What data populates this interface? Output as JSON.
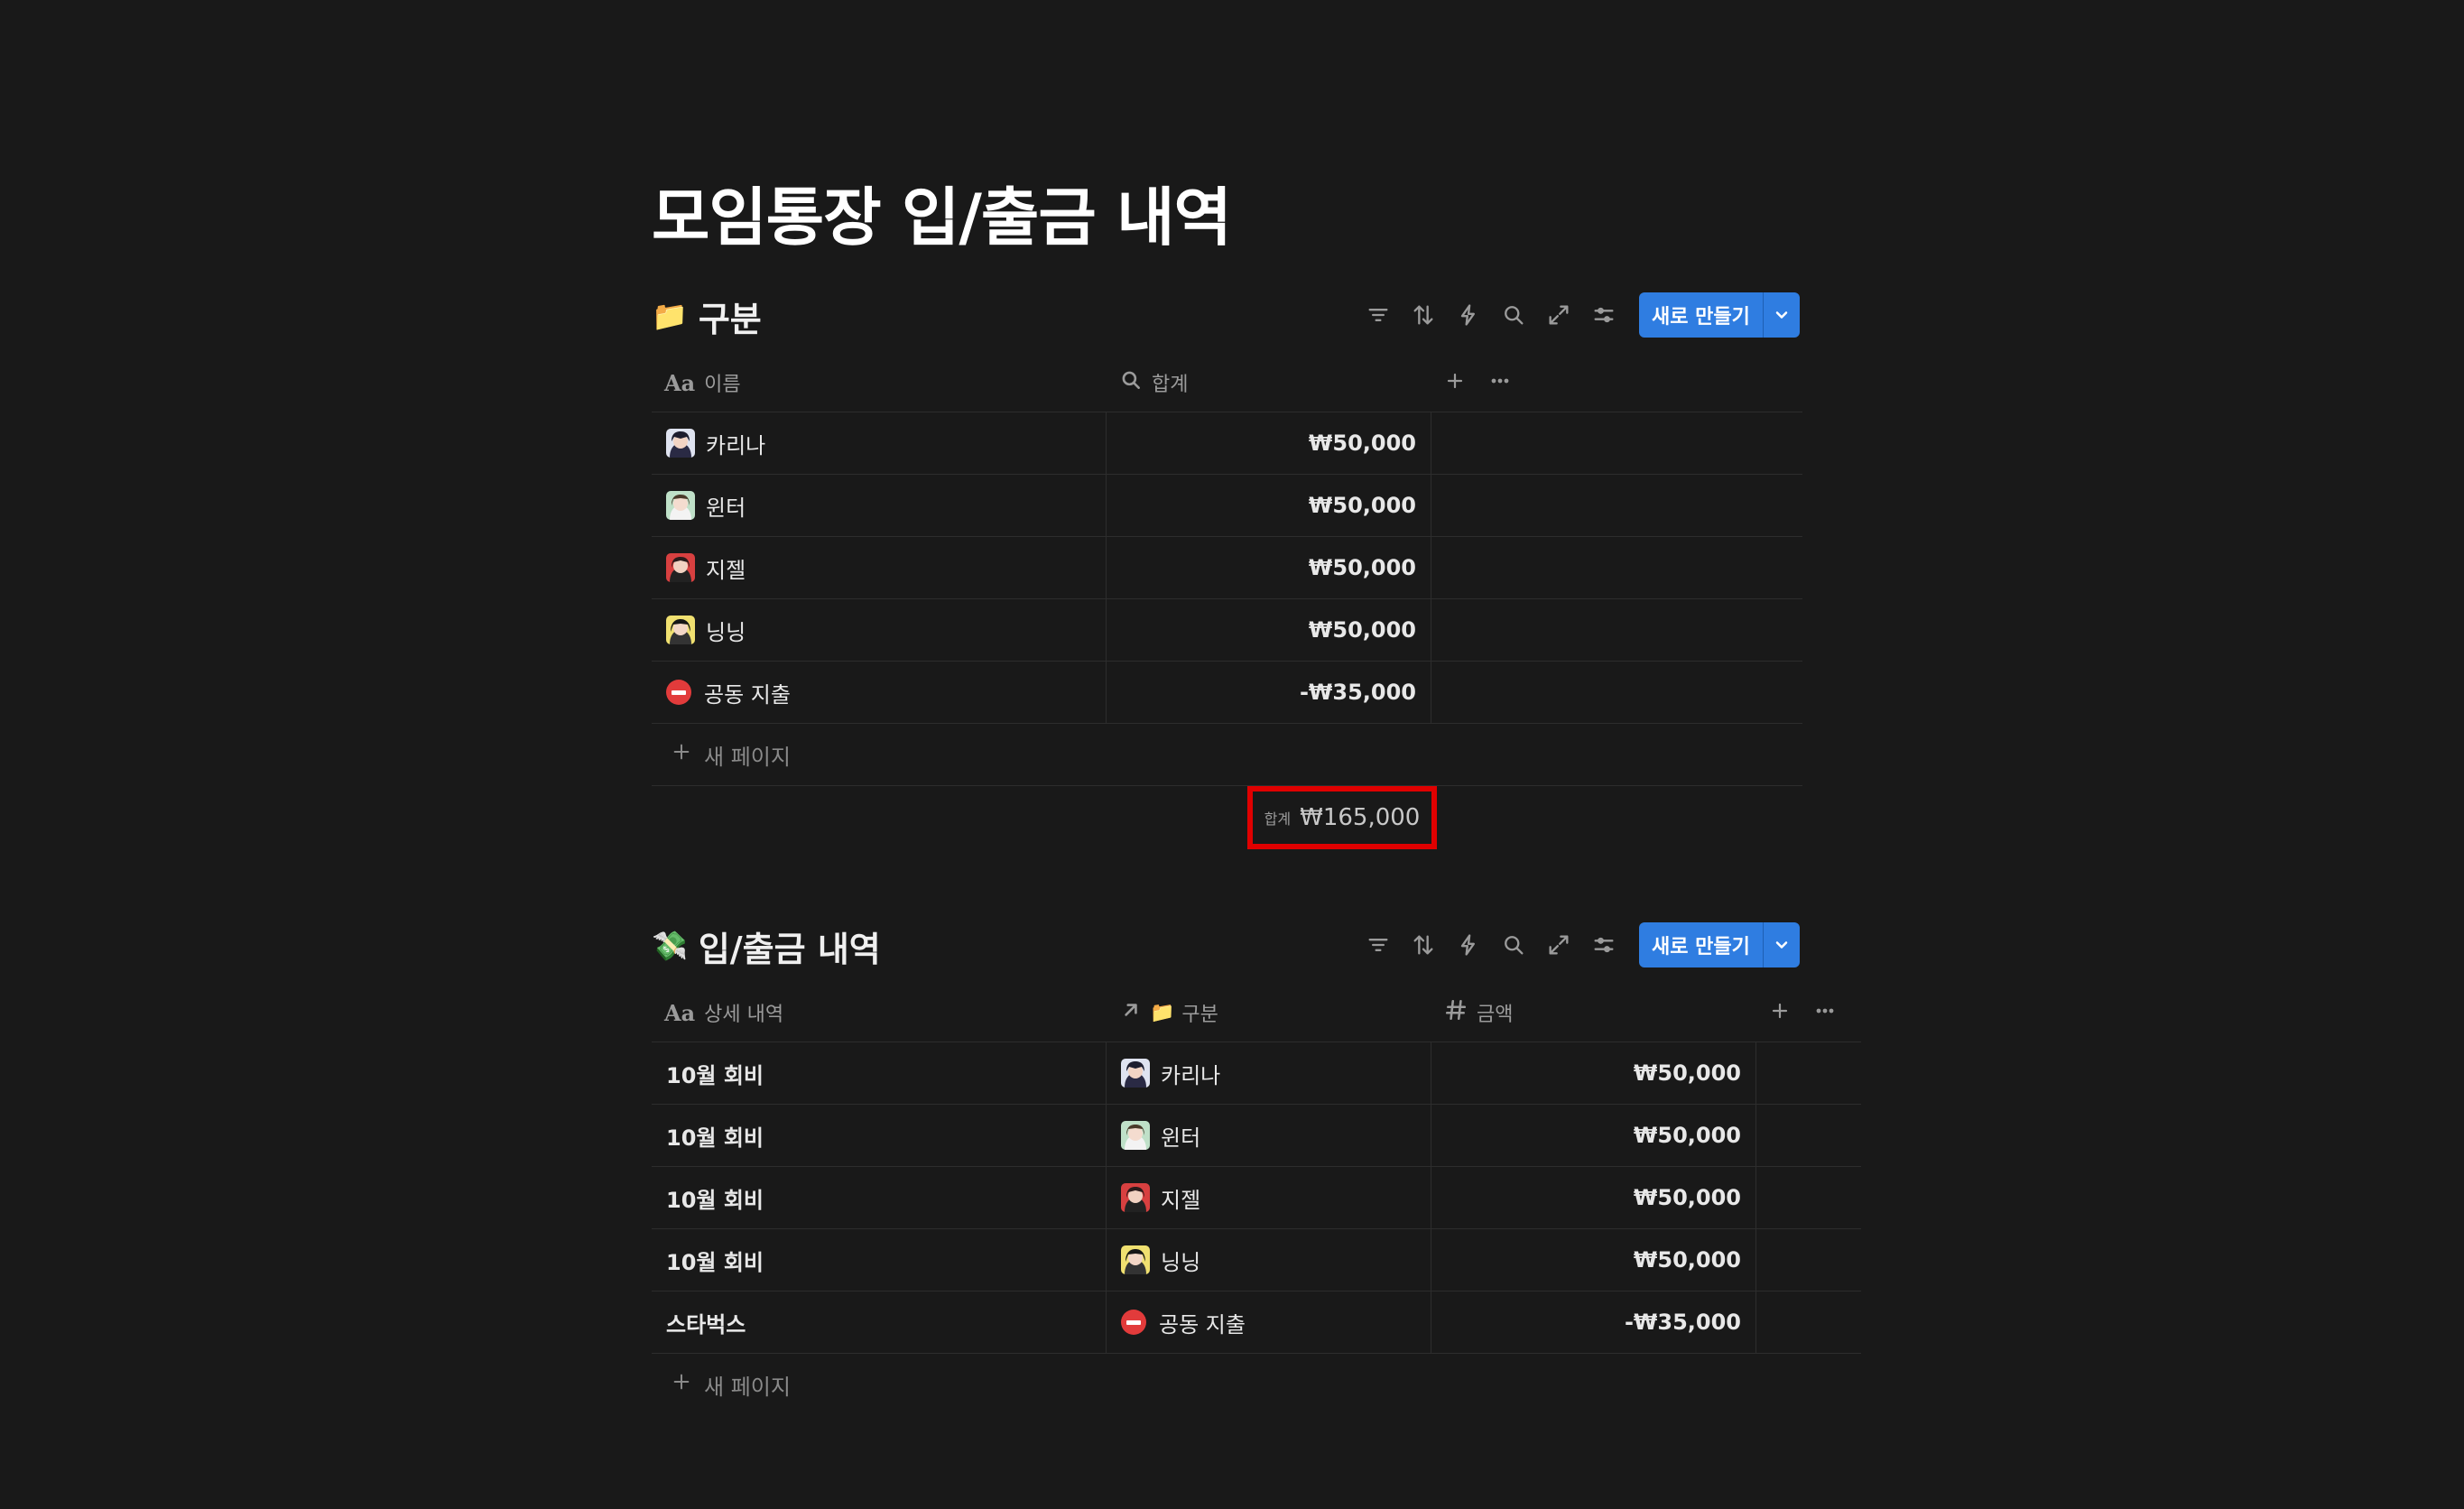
{
  "page": {
    "title": "모임통장 입/출금 내역"
  },
  "db1": {
    "title": "구분",
    "title_emoji": "📁",
    "new_button_label": "새로 만들기",
    "columns": [
      {
        "label": "이름",
        "icon": "title-aa-icon"
      },
      {
        "label": "합계",
        "icon": "search-formula-icon"
      }
    ],
    "rows": [
      {
        "name": "카리나",
        "avatar": "avatar-karina",
        "total": "₩50,000"
      },
      {
        "name": "윈터",
        "avatar": "avatar-winter",
        "total": "₩50,000"
      },
      {
        "name": "지젤",
        "avatar": "avatar-giselle",
        "total": "₩50,000"
      },
      {
        "name": "닝닝",
        "avatar": "avatar-ningning",
        "total": "₩50,000"
      },
      {
        "name": "공동 지출",
        "avatar": "no-entry-icon",
        "total": "-₩35,000"
      }
    ],
    "new_page_label": "새 페이지",
    "calc": {
      "label": "합계",
      "value": "₩165,000"
    }
  },
  "db2": {
    "title": "입/출금 내역",
    "title_emoji": "💸",
    "new_button_label": "새로 만들기",
    "columns": [
      {
        "label": "상세 내역",
        "icon": "title-aa-icon"
      },
      {
        "label": "구분",
        "icon": "relation-arrow-icon"
      },
      {
        "label": "금액",
        "icon": "number-hash-icon"
      }
    ],
    "relation_emoji": "📁",
    "rows": [
      {
        "detail": "10월 회비",
        "category": "카리나",
        "avatar": "avatar-karina",
        "amount": "₩50,000"
      },
      {
        "detail": "10월 회비",
        "category": "윈터",
        "avatar": "avatar-winter",
        "amount": "₩50,000"
      },
      {
        "detail": "10월 회비",
        "category": "지젤",
        "avatar": "avatar-giselle",
        "amount": "₩50,000"
      },
      {
        "detail": "10월 회비",
        "category": "닝닝",
        "avatar": "avatar-ningning",
        "amount": "₩50,000"
      },
      {
        "detail": "스타벅스",
        "category": "공동 지출",
        "avatar": "no-entry-icon",
        "amount": "-₩35,000"
      }
    ],
    "new_page_label": "새 페이지"
  },
  "colors": {
    "background": "#191919",
    "accent": "#2f7de1",
    "highlight_box": "#e00000"
  }
}
